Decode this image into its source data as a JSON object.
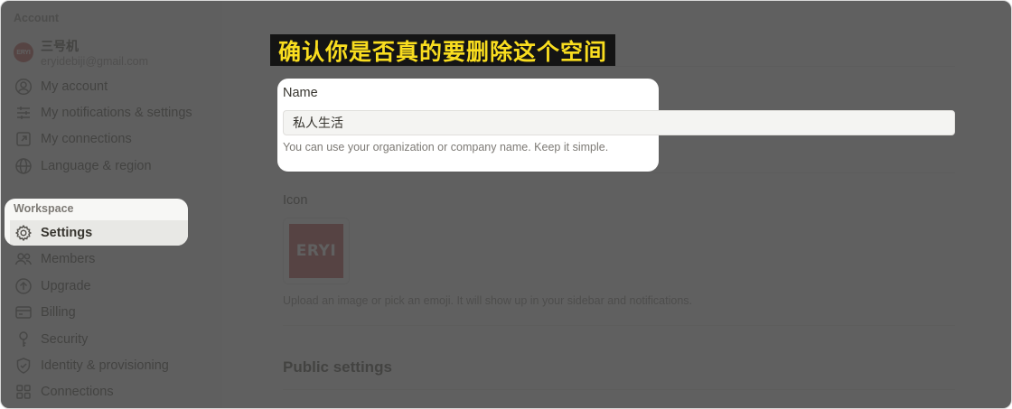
{
  "account": {
    "section_label": "Account",
    "user_name": "三号机",
    "user_email": "eryidebiji@gmail.com",
    "avatar_text": "ERYI",
    "items": [
      {
        "label": "My account",
        "icon": "user-circle-icon"
      },
      {
        "label": "My notifications & settings",
        "icon": "sliders-icon"
      },
      {
        "label": "My connections",
        "icon": "external-link-icon"
      },
      {
        "label": "Language & region",
        "icon": "globe-icon"
      }
    ]
  },
  "workspace": {
    "section_label": "Workspace",
    "items": [
      {
        "label": "Settings",
        "icon": "gear-icon",
        "active": true
      },
      {
        "label": "Members",
        "icon": "people-icon"
      },
      {
        "label": "Upgrade",
        "icon": "arrow-up-circle-icon"
      },
      {
        "label": "Billing",
        "icon": "credit-card-icon"
      },
      {
        "label": "Security",
        "icon": "key-icon"
      },
      {
        "label": "Identity & provisioning",
        "icon": "shield-check-icon"
      },
      {
        "label": "Connections",
        "icon": "grid-icon"
      }
    ]
  },
  "main": {
    "name_label": "Name",
    "name_value": "私人生活",
    "name_hint": "You can use your organization or company name. Keep it simple.",
    "icon_label": "Icon",
    "icon_logo_text": "ERYI",
    "icon_hint": "Upload an image or pick an emoji. It will show up in your sidebar and notifications.",
    "public_settings_title": "Public settings"
  },
  "overlay": {
    "caption": "确认你是否真的要删除这个空间"
  },
  "colors": {
    "caption_bg": "#141414",
    "caption_text": "#f9dd1f",
    "logo_red": "#b83b36",
    "sidebar_bg": "#f7f7f5"
  }
}
